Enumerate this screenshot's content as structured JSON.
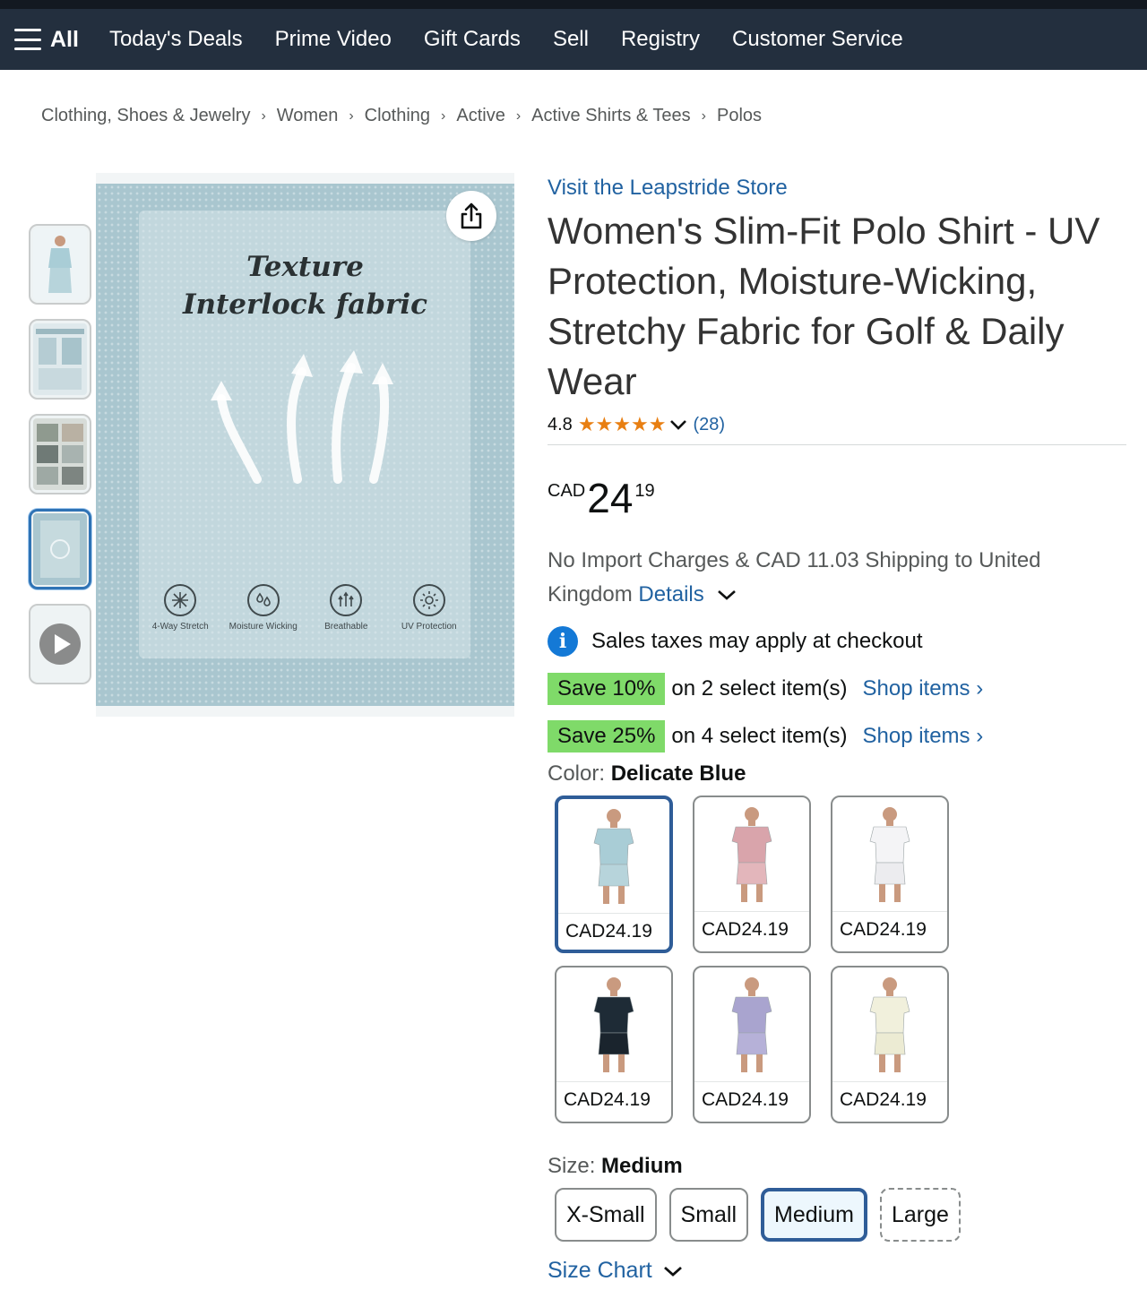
{
  "nav": {
    "all_label": "All",
    "links": [
      "Today's Deals",
      "Prime Video",
      "Gift Cards",
      "Sell",
      "Registry",
      "Customer Service"
    ]
  },
  "breadcrumb": [
    "Clothing, Shoes & Jewelry",
    "Women",
    "Clothing",
    "Active",
    "Active Shirts & Tees",
    "Polos"
  ],
  "gallery": {
    "thumbnail_count": 5,
    "active_thumbnail": 4,
    "image_title_line1": "Texture",
    "image_title_line2": "Interlock fabric",
    "features": [
      "4-Way Stretch",
      "Moisture Wicking",
      "Breathable",
      "UV Protection"
    ],
    "fabric_color": "#a9c6cf"
  },
  "product": {
    "store_link": "Visit the Leapstride Store",
    "title": "Women's Slim-Fit Polo Shirt - UV Protection, Moisture-Wicking, Stretchy Fabric for Golf & Daily Wear",
    "rating": "4.8",
    "stars": "★★★★★",
    "rating_count": "(28)",
    "price_currency": "CAD",
    "price_whole": "24",
    "price_fraction": "19",
    "shipping_text": "No Import Charges & CAD 11.03 Shipping to United Kingdom",
    "details_label": "Details",
    "tax_text": "Sales taxes may apply at checkout"
  },
  "promos": [
    {
      "badge": "Save 10%",
      "text": "on 2 select item(s)",
      "link": "Shop items ›"
    },
    {
      "badge": "Save 25%",
      "text": "on 4 select item(s)",
      "link": "Shop items ›"
    }
  ],
  "color": {
    "label": "Color:",
    "selected": "Delicate Blue",
    "options": [
      {
        "price": "CAD24.19",
        "shirt": "#a9cdd6",
        "bottom": "#b7d4db",
        "selected": true
      },
      {
        "price": "CAD24.19",
        "shirt": "#d9a4ab",
        "bottom": "#e3b6bb",
        "selected": false
      },
      {
        "price": "CAD24.19",
        "shirt": "#f4f4f6",
        "bottom": "#ececef",
        "selected": false
      },
      {
        "price": "CAD24.19",
        "shirt": "#1e2b36",
        "bottom": "#1a242d",
        "selected": false
      },
      {
        "price": "CAD24.19",
        "shirt": "#a9a4cf",
        "bottom": "#b6b1d8",
        "selected": false
      },
      {
        "price": "CAD24.19",
        "shirt": "#f1f0dc",
        "bottom": "#ecebd3",
        "selected": false
      }
    ]
  },
  "size": {
    "label": "Size:",
    "selected": "Medium",
    "options": [
      "X-Small",
      "Small",
      "Medium",
      "Large"
    ],
    "chart_label": "Size Chart"
  },
  "colors": {
    "nav_bg": "#232f3e",
    "link": "#2162a1",
    "star": "#e87f12",
    "save_badge": "#7fda69",
    "selected_border": "#2f5d98"
  }
}
